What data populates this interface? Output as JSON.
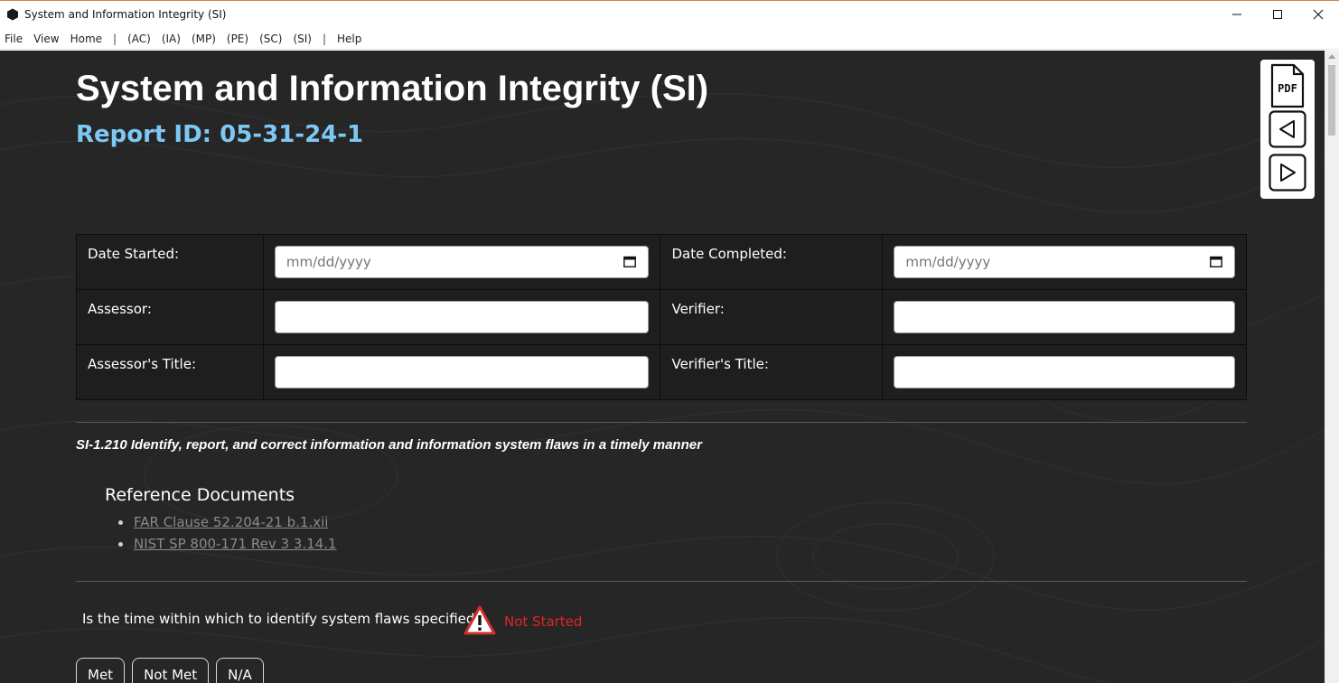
{
  "window": {
    "title": "System and Information Integrity (SI)"
  },
  "menu": {
    "items": [
      "File",
      "View",
      "Home",
      "|",
      "(AC)",
      "(IA)",
      "(MP)",
      "(PE)",
      "(SC)",
      "(SI)",
      "|",
      "Help"
    ]
  },
  "page": {
    "title": "System and Information Integrity (SI)",
    "report_id": "Report ID: 05-31-24-1"
  },
  "form": {
    "date_started_label": "Date Started:",
    "date_started_placeholder": "mm/dd/yyyy",
    "date_completed_label": "Date Completed:",
    "date_completed_placeholder": "mm/dd/yyyy",
    "assessor_label": "Assessor:",
    "verifier_label": "Verifier:",
    "assessor_title_label": "Assessor's Title:",
    "verifier_title_label": "Verifier's Title:"
  },
  "control": {
    "title": "SI-1.210 Identify, report, and correct information and information system flaws in a timely manner",
    "reference_heading": "Reference Documents",
    "references": [
      "FAR Clause 52.204-21 b.1.xii",
      "NIST SP 800-171 Rev 3 3.14.1"
    ]
  },
  "question": {
    "text": "Is the time within which to identify system flaws specified?",
    "status": "Not Started",
    "options": [
      "Met",
      "Not Met",
      "N/A"
    ]
  },
  "toolbar": {
    "pdf_label": "PDF"
  },
  "colors": {
    "background": "#262626",
    "accent_blue": "#7ec8f4",
    "status_red": "#e02424"
  }
}
